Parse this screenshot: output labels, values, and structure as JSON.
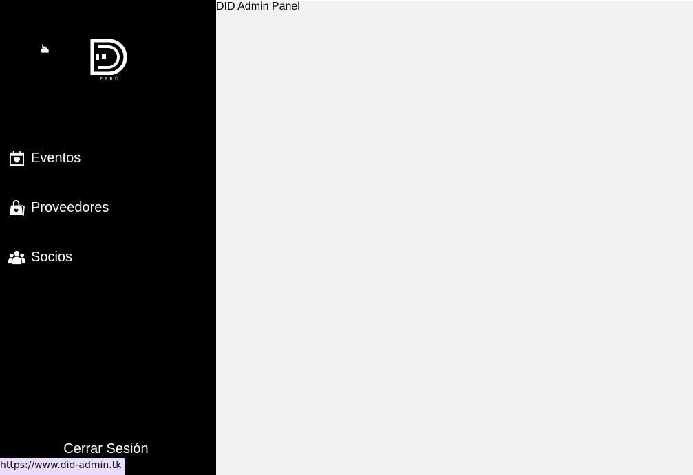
{
  "app": {
    "title": "DID Admin Panel",
    "logo_subtext": "PERÚ"
  },
  "sidebar": {
    "items": [
      {
        "label": "Eventos",
        "icon": "calendar-heart-icon"
      },
      {
        "label": "Proveedores",
        "icon": "shopping-bag-icon"
      },
      {
        "label": "Socios",
        "icon": "users-group-icon"
      }
    ],
    "logout_label": "Cerrar Sesión"
  },
  "status_bar": {
    "url": "https://www.did-admin.tk"
  },
  "colors": {
    "sidebar_bg": "#000000",
    "main_bg": "#f2f2f2",
    "status_bg": "#e9dcff",
    "text_light": "#ffffff"
  }
}
